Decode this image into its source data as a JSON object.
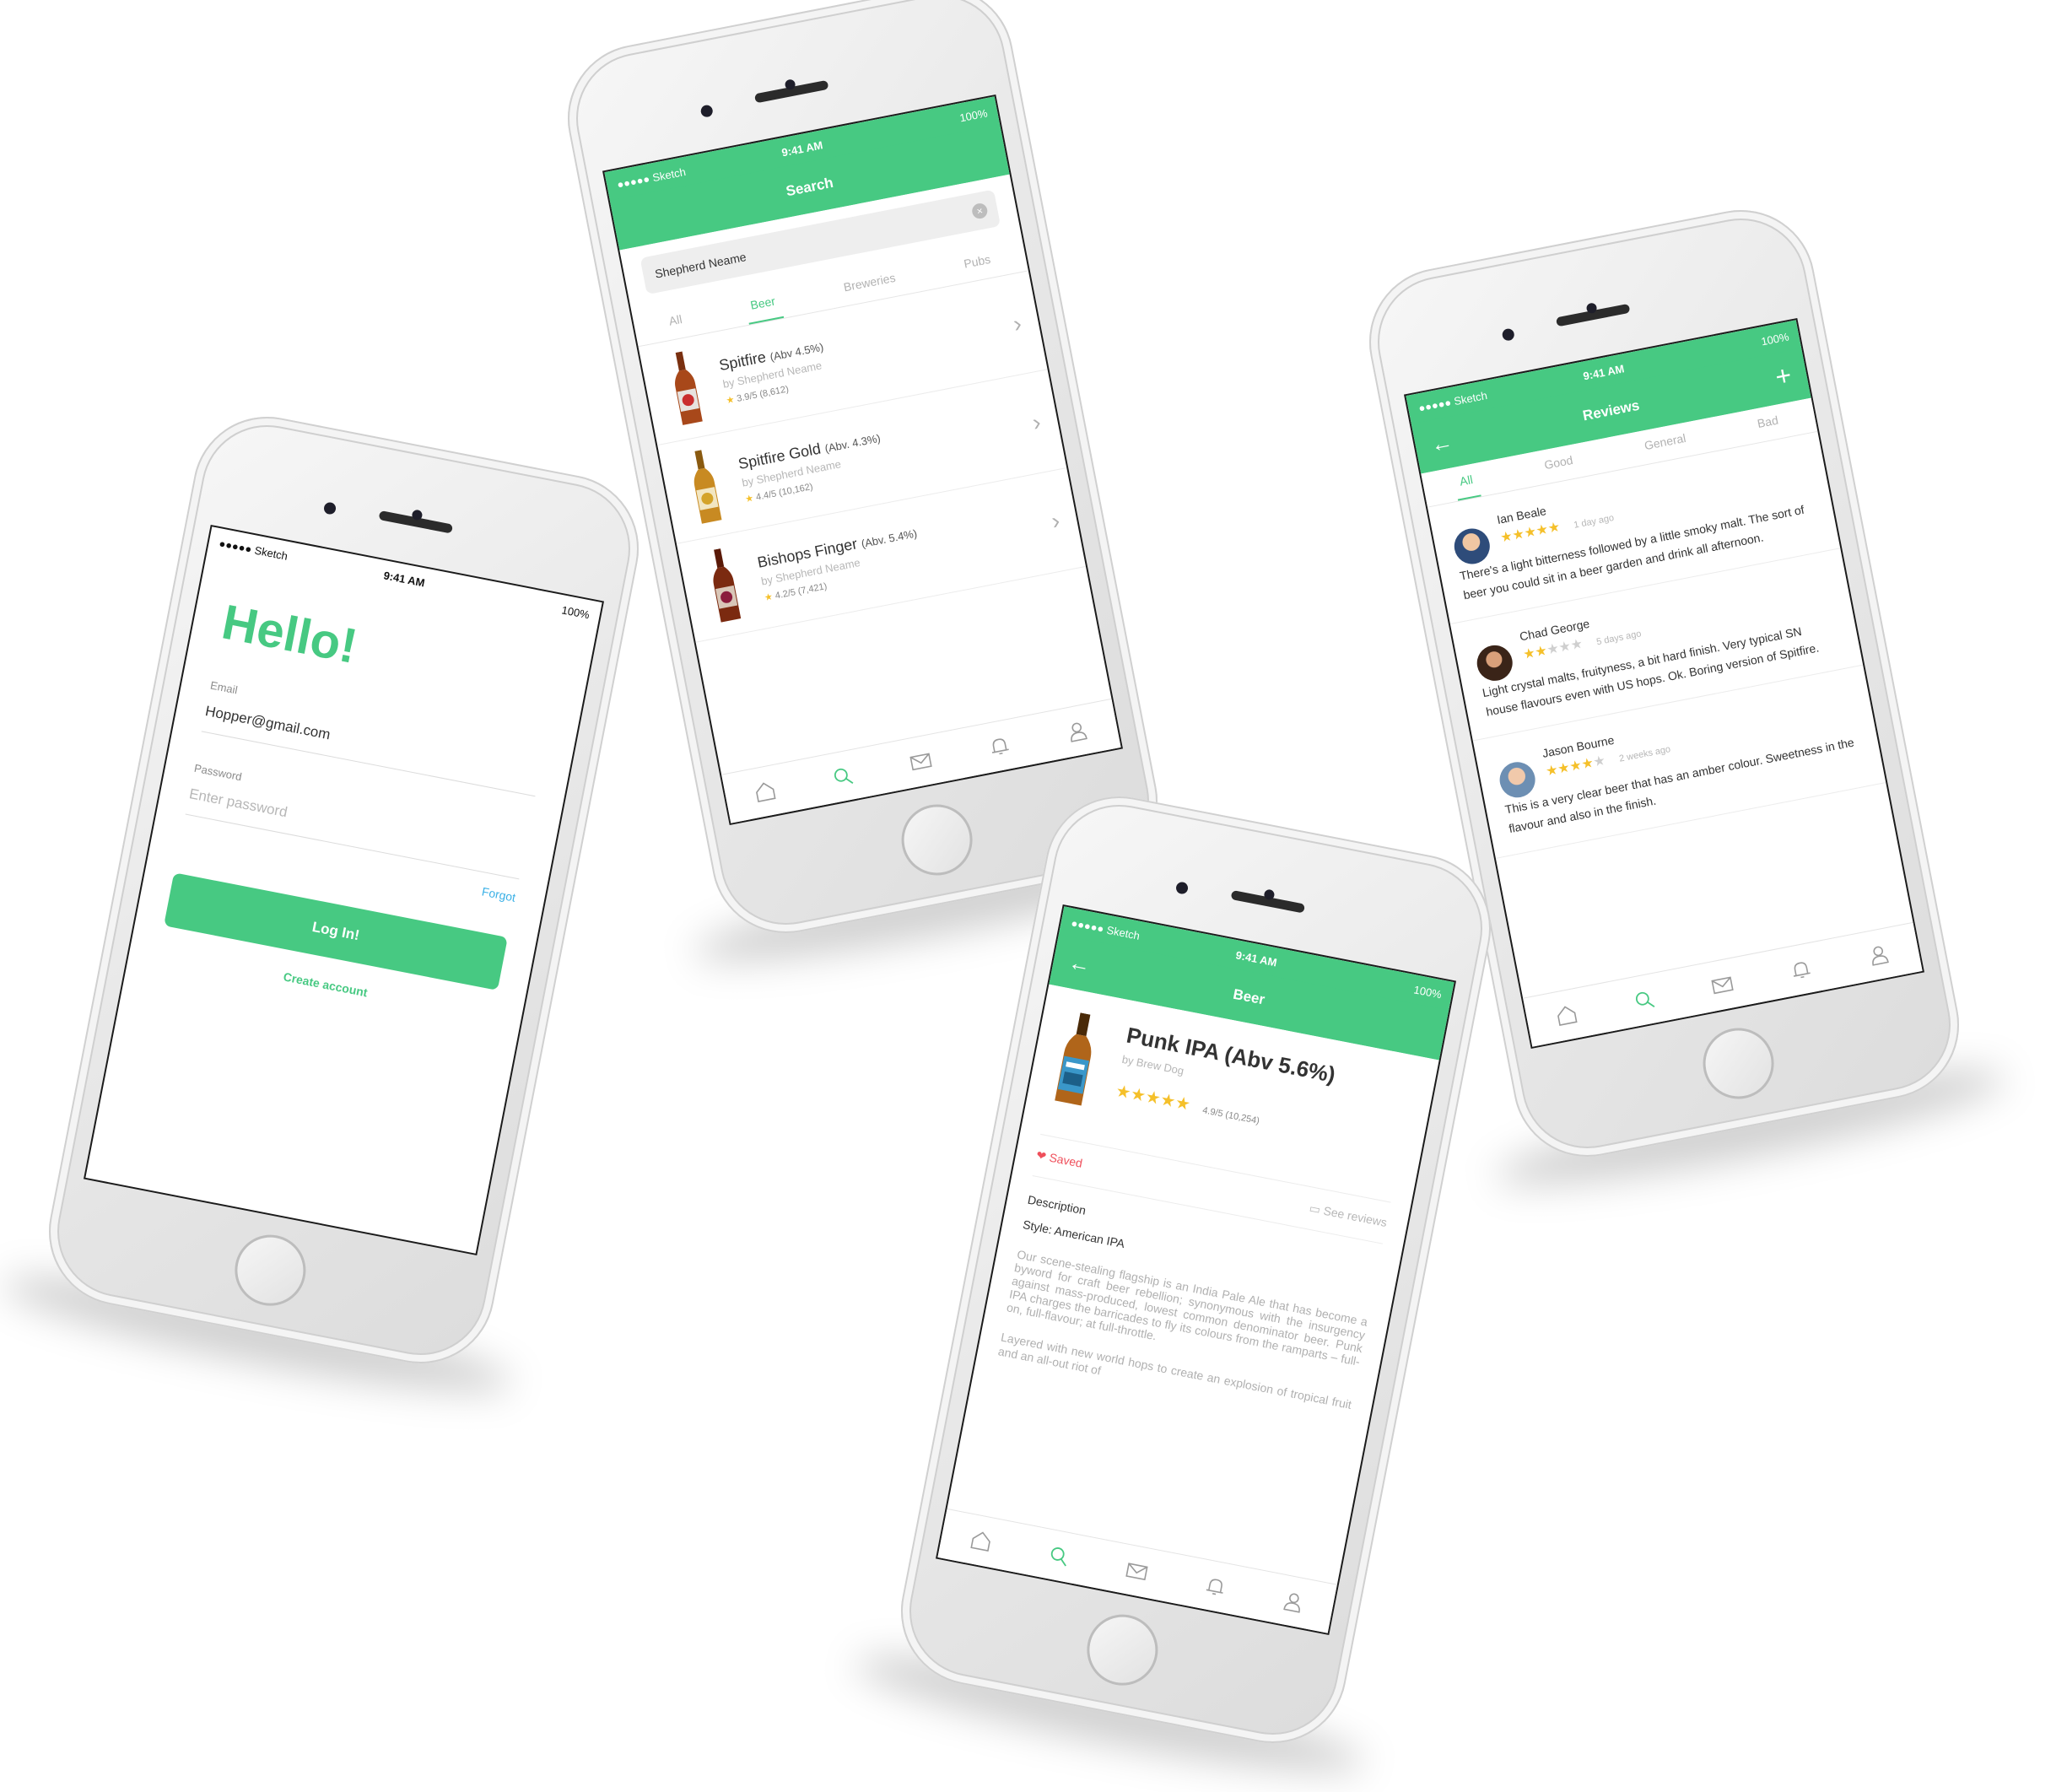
{
  "status": {
    "carrier": "●●●●● Sketch",
    "time": "9:41 AM",
    "battery": "100%"
  },
  "login": {
    "title": "Hello!",
    "email_label": "Email",
    "email_value": "Hopper@gmail.com",
    "password_label": "Password",
    "password_placeholder": "Enter password",
    "forgot": "Forgot",
    "login_button": "Log In!",
    "create_account": "Create account"
  },
  "search": {
    "title": "Search",
    "query": "Shepherd Neame",
    "clear_icon": "×",
    "tabs": [
      "All",
      "Beer",
      "Breweries",
      "Pubs"
    ],
    "results": [
      {
        "name": "Spitfire",
        "abv": "(Abv 4.5%)",
        "by": "by Shepherd Neame",
        "rating": "3.9/5 (8,612)",
        "chevron": "›"
      },
      {
        "name": "Spitfire Gold",
        "abv": "(Abv. 4.3%)",
        "by": "by Shepherd Neame",
        "rating": "4.4/5 (10,162)",
        "chevron": "›"
      },
      {
        "name": "Bishops Finger",
        "abv": "(Abv. 5.4%)",
        "by": "by Shepherd Neame",
        "rating": "4.2/5 (7,421)",
        "chevron": "›"
      }
    ]
  },
  "beer": {
    "title": "Beer",
    "back": "←",
    "name": "Punk IPA (Abv 5.6%)",
    "by": "by Brew Dog",
    "stars": 5,
    "rating": "4.9/5 (10,254)",
    "saved": "Saved",
    "see_reviews": "See reviews",
    "description_label": "Description",
    "style": "Style: American IPA",
    "paragraph1": "Our scene-stealing flagship is an India Pale Ale that has become a byword for craft beer rebellion; synonymous with the insurgency against mass-produced, lowest common denominator beer. Punk IPA charges the barricades to fly its colours from the ramparts – full-on, full-flavour; at full-throttle.",
    "paragraph2": "Layered with new world hops to create an explosion of tropical fruit and an all-out riot of"
  },
  "reviews": {
    "title": "Reviews",
    "back": "←",
    "add": "+",
    "tabs": [
      "All",
      "Good",
      "General",
      "Bad"
    ],
    "items": [
      {
        "name": "Ian Beale",
        "stars": 5,
        "time": "1 day ago",
        "text": "There's a light bitterness followed by a little smoky malt. The sort of beer you could sit in a beer garden and drink all afternoon."
      },
      {
        "name": "Chad George",
        "stars": 2,
        "time": "5 days ago",
        "text": "Light crystal malts, fruityness, a bit hard finish. Very typical SN house flavours even with US hops. Ok. Boring version of Spitfire."
      },
      {
        "name": "Jason Bourne",
        "stars": 4,
        "time": "2 weeks ago",
        "text": "This is a very clear beer that has an amber colour. Sweetness in the flavour and also in the finish."
      }
    ]
  },
  "icons": [
    "home-icon",
    "search-icon",
    "mail-icon",
    "bell-icon",
    "user-icon"
  ],
  "colors": {
    "accent": "#47c982",
    "link": "#3ab0e6",
    "saved": "#ef4f5b",
    "star": "#f5c02a"
  }
}
